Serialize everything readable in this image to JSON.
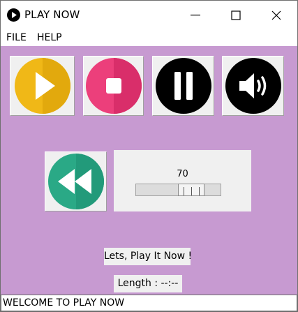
{
  "window": {
    "title": "PLAY NOW",
    "controls": {
      "minimize_icon": "minimize-icon",
      "maximize_icon": "maximize-icon",
      "close_icon": "close-icon"
    }
  },
  "menu": {
    "items": [
      "FILE",
      "HELP"
    ]
  },
  "player_buttons": [
    {
      "name": "play",
      "icon": "play-icon",
      "color": "#f0b817"
    },
    {
      "name": "stop",
      "icon": "stop-icon",
      "color": "#ec3f7b"
    },
    {
      "name": "pause",
      "icon": "pause-icon",
      "color": "#000000"
    },
    {
      "name": "volume",
      "icon": "volume-icon",
      "color": "#000000"
    }
  ],
  "rewind_button": {
    "icon": "rewind-icon",
    "color": "#2aa986"
  },
  "volume_slider": {
    "value": "70",
    "level": 70
  },
  "labels": {
    "now_playing": "Lets, Play It Now !",
    "length": "Length : --:--"
  },
  "status_bar": {
    "text": "WELCOME TO PLAY NOW"
  },
  "colors": {
    "background": "#c79ad1",
    "panel": "#f0f0f0"
  }
}
